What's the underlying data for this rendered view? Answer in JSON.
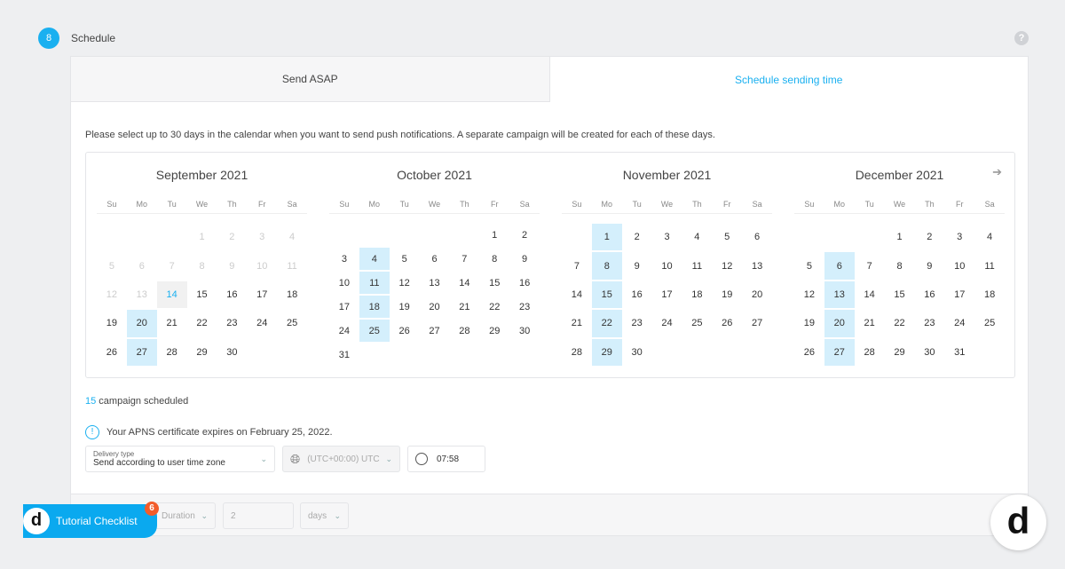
{
  "step": {
    "number": "8",
    "title": "Schedule",
    "help": "?"
  },
  "tabs": [
    {
      "label": "Send ASAP"
    },
    {
      "label": "Schedule sending time"
    }
  ],
  "description": "Please select up to 30 days in the calendar when you want to send push notifications. A separate campaign will be created for each of these days.",
  "weekdays": [
    "Su",
    "Mo",
    "Tu",
    "We",
    "Th",
    "Fr",
    "Sa"
  ],
  "months": [
    {
      "title": "September 2021",
      "first_weekday": 3,
      "days": 30,
      "disabled_before": 14,
      "today": 14,
      "selected": [
        20,
        27
      ]
    },
    {
      "title": "October 2021",
      "first_weekday": 5,
      "days": 31,
      "disabled_before": 0,
      "today": null,
      "selected": [
        4,
        11,
        18,
        25
      ]
    },
    {
      "title": "November 2021",
      "first_weekday": 1,
      "days": 30,
      "disabled_before": 0,
      "today": null,
      "selected": [
        1,
        8,
        15,
        22,
        29
      ]
    },
    {
      "title": "December 2021",
      "first_weekday": 3,
      "days": 31,
      "disabled_before": 0,
      "today": null,
      "selected": [
        6,
        13,
        20,
        27
      ]
    }
  ],
  "next_icon": "arrow-right-icon",
  "campaign_count": "15",
  "campaign_label": " campaign scheduled",
  "apns_warning": "Your APNS certificate expires on February 25, 2022.",
  "delivery": {
    "label": "Delivery type",
    "value": "Send according to user time zone"
  },
  "timezone": "(UTC+00:00) UTC",
  "time": "07:58",
  "footer": {
    "duration": "Duration",
    "amount": "2",
    "unit": "days"
  },
  "tutorial": {
    "label": "Tutorial Checklist",
    "badge": "6"
  },
  "colors": {
    "accent": "#1ab0f0",
    "selected": "#d4effc",
    "badge": "#f25c2a"
  }
}
